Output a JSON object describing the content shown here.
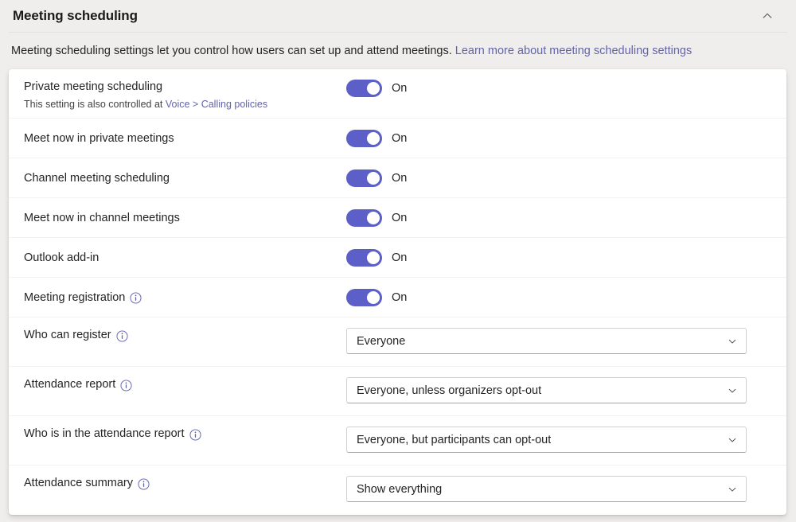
{
  "header": {
    "title": "Meeting scheduling",
    "collapse_icon": "chevron-up-icon"
  },
  "description": {
    "text": "Meeting scheduling settings let you control how users can set up and attend meetings. ",
    "link_text": "Learn more about meeting scheduling settings"
  },
  "colors": {
    "accent": "#6264a7",
    "toggle_on": "#5b5fc7",
    "page_background": "#f0eeed",
    "card_background": "#ffffff",
    "link": "#6264a7"
  },
  "settings": [
    {
      "label": "Private meeting scheduling",
      "sub_text": "This setting is also controlled at ",
      "sub_link": "Voice > Calling policies",
      "control": "toggle",
      "value": "On",
      "has_info": false
    },
    {
      "label": "Meet now in private meetings",
      "control": "toggle",
      "value": "On",
      "has_info": false
    },
    {
      "label": "Channel meeting scheduling",
      "control": "toggle",
      "value": "On",
      "has_info": false
    },
    {
      "label": "Meet now in channel meetings",
      "control": "toggle",
      "value": "On",
      "has_info": false
    },
    {
      "label": "Outlook add-in",
      "control": "toggle",
      "value": "On",
      "has_info": false
    },
    {
      "label": "Meeting registration",
      "control": "toggle",
      "value": "On",
      "has_info": true
    },
    {
      "label": "Who can register",
      "control": "dropdown",
      "value": "Everyone",
      "has_info": true
    },
    {
      "label": "Attendance report",
      "control": "dropdown",
      "value": "Everyone, unless organizers opt-out",
      "has_info": true
    },
    {
      "label": "Who is in the attendance report",
      "control": "dropdown",
      "value": "Everyone, but participants can opt-out",
      "has_info": true
    },
    {
      "label": "Attendance summary",
      "control": "dropdown",
      "value": "Show everything",
      "has_info": true
    }
  ]
}
